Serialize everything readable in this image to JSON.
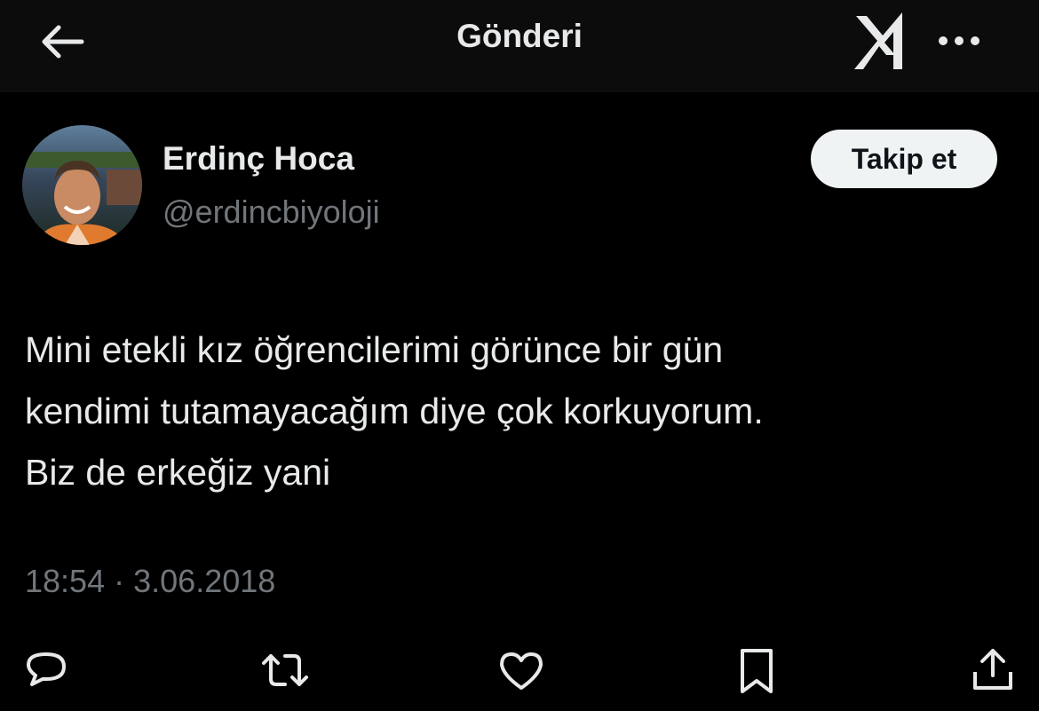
{
  "header": {
    "title": "Gönderi",
    "back_icon": "arrow-left-icon",
    "logo_icon": "x-logo-icon",
    "more_icon": "more-horizontal-icon"
  },
  "author": {
    "display_name": "Erdinç Hoca",
    "handle": "@erdincbiyoloji",
    "follow_label": "Takip et"
  },
  "tweet": {
    "text": "Mini etekli kız öğrencilerimi görünce bir gün\nkendimi tutamayacağım diye çok korkuyorum.\nBiz de erkeğiz yani",
    "time": "18:54",
    "separator": "·",
    "date": "3.06.2018"
  },
  "actions": [
    {
      "icon": "reply-icon"
    },
    {
      "icon": "retweet-icon"
    },
    {
      "icon": "like-icon"
    },
    {
      "icon": "bookmark-icon"
    },
    {
      "icon": "share-icon"
    }
  ],
  "colors": {
    "background": "#000000",
    "topbar": "#0c0c0c",
    "text": "#e7e9ea",
    "secondary": "#71767b",
    "follow_bg": "#eff3f4"
  }
}
